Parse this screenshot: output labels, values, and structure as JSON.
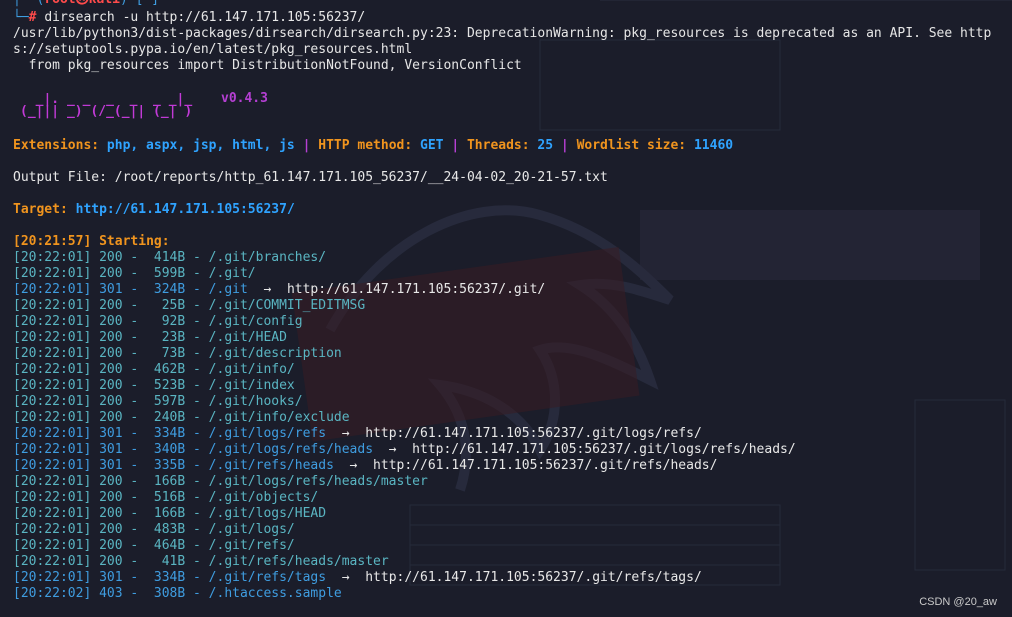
{
  "prompt": {
    "user": "root",
    "host": "kali",
    "cwd": "~",
    "hash": "#"
  },
  "command": "dirsearch -u http://61.147.171.105:56237/",
  "warning": {
    "line1": "/usr/lib/python3/dist-packages/dirsearch/dirsearch.py:23: DeprecationWarning: pkg_resources is deprecated as an API. See http",
    "line2": "s://setuptools.pypa.io/en/latest/pkg_resources.html",
    "line3": "  from pkg_resources import DistributionNotFound, VersionConflict"
  },
  "banner": {
    "art1": "  _|. _ _  _  _  _ _|_",
    "art2": "(_||| _) (/_(_|| (_| )",
    "version": "v0.4.3"
  },
  "config": {
    "ext_label": "Extensions:",
    "ext_value": "php, aspx, jsp, html, js",
    "sep": "|",
    "method_label": "HTTP method:",
    "method_value": "GET",
    "threads_label": "Threads:",
    "threads_value": "25",
    "wordlist_label": "Wordlist size:",
    "wordlist_value": "11460"
  },
  "output_file": "Output File: /root/reports/http_61.147.171.105_56237/__24-04-02_20-21-57.txt",
  "target": {
    "label": "Target:",
    "url": "http://61.147.171.105:56237/"
  },
  "starting": {
    "time": "[20:21:57]",
    "text": "Starting:"
  },
  "results": [
    {
      "time": "[20:22:01]",
      "status": "200",
      "size": "414B",
      "path": "/.git/branches/",
      "redirect": ""
    },
    {
      "time": "[20:22:01]",
      "status": "200",
      "size": "599B",
      "path": "/.git/",
      "redirect": ""
    },
    {
      "time": "[20:22:01]",
      "status": "301",
      "size": "324B",
      "path": "/.git",
      "redirect": "http://61.147.171.105:56237/.git/"
    },
    {
      "time": "[20:22:01]",
      "status": "200",
      "size": "25B",
      "path": "/.git/COMMIT_EDITMSG",
      "redirect": ""
    },
    {
      "time": "[20:22:01]",
      "status": "200",
      "size": "92B",
      "path": "/.git/config",
      "redirect": ""
    },
    {
      "time": "[20:22:01]",
      "status": "200",
      "size": "23B",
      "path": "/.git/HEAD",
      "redirect": ""
    },
    {
      "time": "[20:22:01]",
      "status": "200",
      "size": "73B",
      "path": "/.git/description",
      "redirect": ""
    },
    {
      "time": "[20:22:01]",
      "status": "200",
      "size": "462B",
      "path": "/.git/info/",
      "redirect": ""
    },
    {
      "time": "[20:22:01]",
      "status": "200",
      "size": "523B",
      "path": "/.git/index",
      "redirect": ""
    },
    {
      "time": "[20:22:01]",
      "status": "200",
      "size": "597B",
      "path": "/.git/hooks/",
      "redirect": ""
    },
    {
      "time": "[20:22:01]",
      "status": "200",
      "size": "240B",
      "path": "/.git/info/exclude",
      "redirect": ""
    },
    {
      "time": "[20:22:01]",
      "status": "301",
      "size": "334B",
      "path": "/.git/logs/refs",
      "redirect": "http://61.147.171.105:56237/.git/logs/refs/"
    },
    {
      "time": "[20:22:01]",
      "status": "301",
      "size": "340B",
      "path": "/.git/logs/refs/heads",
      "redirect": "http://61.147.171.105:56237/.git/logs/refs/heads/"
    },
    {
      "time": "[20:22:01]",
      "status": "301",
      "size": "335B",
      "path": "/.git/refs/heads",
      "redirect": "http://61.147.171.105:56237/.git/refs/heads/"
    },
    {
      "time": "[20:22:01]",
      "status": "200",
      "size": "166B",
      "path": "/.git/logs/refs/heads/master",
      "redirect": ""
    },
    {
      "time": "[20:22:01]",
      "status": "200",
      "size": "516B",
      "path": "/.git/objects/",
      "redirect": ""
    },
    {
      "time": "[20:22:01]",
      "status": "200",
      "size": "166B",
      "path": "/.git/logs/HEAD",
      "redirect": ""
    },
    {
      "time": "[20:22:01]",
      "status": "200",
      "size": "483B",
      "path": "/.git/logs/",
      "redirect": ""
    },
    {
      "time": "[20:22:01]",
      "status": "200",
      "size": "464B",
      "path": "/.git/refs/",
      "redirect": ""
    },
    {
      "time": "[20:22:01]",
      "status": "200",
      "size": "41B",
      "path": "/.git/refs/heads/master",
      "redirect": ""
    },
    {
      "time": "[20:22:01]",
      "status": "301",
      "size": "334B",
      "path": "/.git/refs/tags",
      "redirect": "http://61.147.171.105:56237/.git/refs/tags/"
    },
    {
      "time": "[20:22:02]",
      "status": "403",
      "size": "308B",
      "path": "/.htaccess.sample",
      "redirect": ""
    }
  ],
  "watermark": "CSDN @20_aw",
  "colors": {
    "background": "#1b1d2a",
    "ok": "#5ab5c2",
    "redirect": "#3f9de0",
    "forbidden": "#3f7fd0",
    "accent": "#f0941e",
    "banner": "#c13ad6"
  }
}
